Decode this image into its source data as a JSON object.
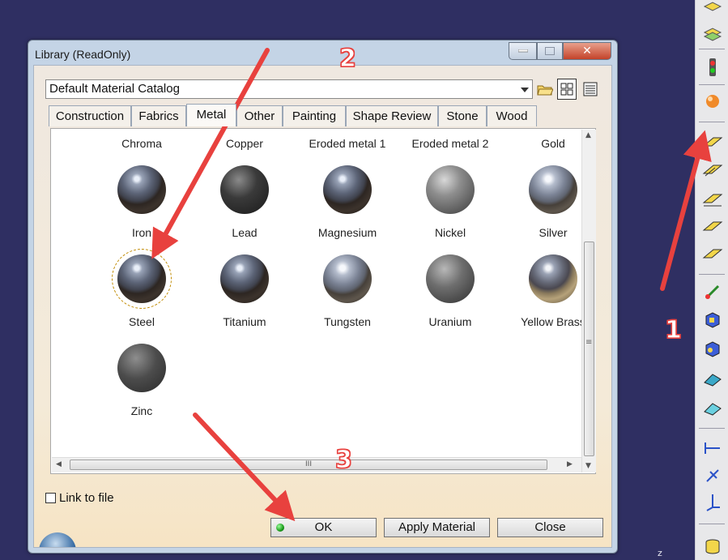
{
  "dialog": {
    "title": "Library (ReadOnly)",
    "catalog_value": "Default Material Catalog",
    "tabs": [
      "Construction",
      "Fabrics",
      "Metal",
      "Other",
      "Painting",
      "Shape Review",
      "Stone",
      "Wood"
    ],
    "active_tab": "Metal",
    "materials": [
      {
        "name": "Chroma"
      },
      {
        "name": "Copper"
      },
      {
        "name": "Eroded metal 1"
      },
      {
        "name": "Eroded metal 2"
      },
      {
        "name": "Gold"
      },
      {
        "name": "Iron"
      },
      {
        "name": "Lead"
      },
      {
        "name": "Magnesium"
      },
      {
        "name": "Nickel"
      },
      {
        "name": "Silver"
      },
      {
        "name": "Steel",
        "selected": true
      },
      {
        "name": "Titanium"
      },
      {
        "name": "Tungsten"
      },
      {
        "name": "Uranium"
      },
      {
        "name": "Yellow Brass"
      },
      {
        "name": "Zinc"
      }
    ],
    "link_to_file": "Link to file",
    "buttons": {
      "ok": "OK",
      "apply": "Apply Material",
      "close": "Close"
    },
    "scroll_grip": "III",
    "vscroll_grip": "≡"
  },
  "annotations": {
    "step1": "1",
    "step2": "2",
    "step3": "3",
    "color": "#e8413e"
  },
  "corner_label": "z",
  "colors": {
    "desktop": "#2f2f62",
    "accent_arrow": "#e8413e"
  }
}
